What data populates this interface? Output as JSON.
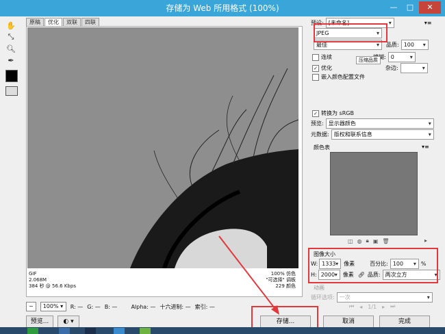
{
  "window": {
    "title": "存储为 Web 所用格式 (100%)"
  },
  "tabs": [
    "原稿",
    "优化",
    "双联",
    "四联"
  ],
  "info": {
    "format": "GIF",
    "size": "2.068M",
    "time": "384 秒 @ 56.6 Kbps",
    "quality": "100% 仿色",
    "palette": "\"可选择\" 调板",
    "colors": "229 颜色"
  },
  "status": {
    "zoom": "100%",
    "r": "R: —",
    "g": "G: —",
    "b": "B: —",
    "alpha": "Alpha: —",
    "hex": "十六进制: —",
    "index": "索引: —"
  },
  "bottom": {
    "preview": "预览...",
    "save": "存储...",
    "cancel": "取消",
    "done": "完成"
  },
  "settings": {
    "preset_label": "预设:",
    "preset_value": "[未命名]",
    "format": "JPEG",
    "quality_level": "最佳",
    "quality_label": "品质:",
    "quality_value": "100",
    "progressive": "连续",
    "blur_label": "模糊:",
    "blur_value": "0",
    "optimized": "优化",
    "matte_label": "杂边:",
    "embed_profile": "嵌入颜色配置文件",
    "tooltip": "压缩品质",
    "convert_srgb": "转换为 sRGB",
    "preview_label": "预览:",
    "preview_value": "显示器颜色",
    "metadata_label": "元数据:",
    "metadata_value": "版权和联系信息",
    "color_table": "颜色表"
  },
  "image_size": {
    "title": "图像大小",
    "w_label": "W:",
    "w_value": "1333",
    "h_label": "H:",
    "h_value": "2000",
    "unit": "像素",
    "percent_label": "百分比:",
    "percent_value": "100",
    "pct_sign": "%",
    "quality_label": "品质:",
    "quality_value": "两次立方"
  },
  "animation": {
    "title": "动画",
    "loop_label": "循环选项:",
    "loop_value": "一次",
    "frame": "1/1"
  }
}
